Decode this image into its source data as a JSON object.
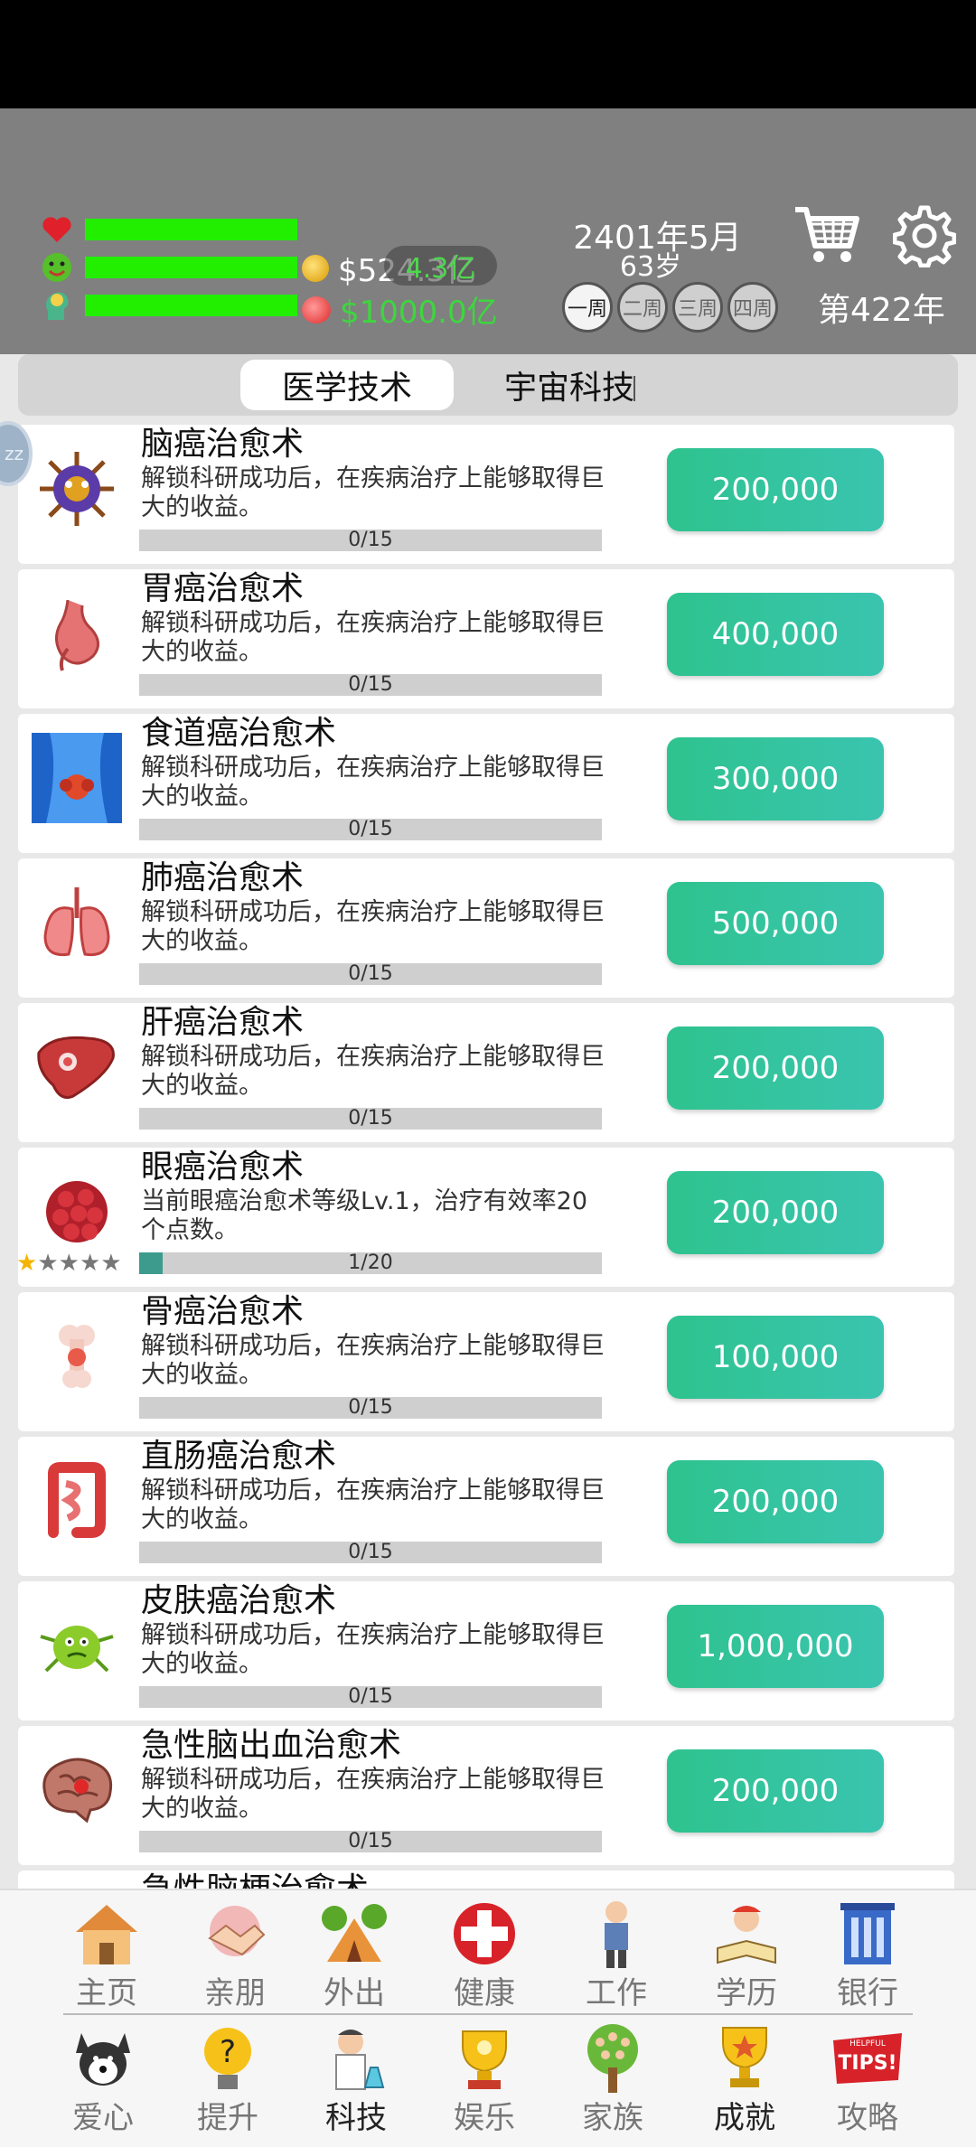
{
  "header": {
    "money": "$524.3亿",
    "ghost_value": "4.3亿",
    "gems": "$1000.0亿",
    "date": "2401年5月",
    "age": "63岁",
    "weeks": [
      "一周",
      "二周",
      "三周",
      "四周"
    ],
    "active_week": "一周",
    "year": "第422年",
    "stat_bar_color": "#22ee00"
  },
  "tabs": {
    "active": "医学技术",
    "second": "宇宙科技"
  },
  "side_bubble": "zz",
  "techs": [
    {
      "title": "脑癌治愈术",
      "desc": "解锁科研成功后，在疾病治疗上能够取得巨大的收益。",
      "progress": "0/15",
      "progress_fraction": 0,
      "price": "200,000"
    },
    {
      "title": "胃癌治愈术",
      "desc": "解锁科研成功后，在疾病治疗上能够取得巨大的收益。",
      "progress": "0/15",
      "progress_fraction": 0,
      "price": "400,000"
    },
    {
      "title": "食道癌治愈术",
      "desc": "解锁科研成功后，在疾病治疗上能够取得巨大的收益。",
      "progress": "0/15",
      "progress_fraction": 0,
      "price": "300,000"
    },
    {
      "title": "肺癌治愈术",
      "desc": "解锁科研成功后，在疾病治疗上能够取得巨大的收益。",
      "progress": "0/15",
      "progress_fraction": 0,
      "price": "500,000"
    },
    {
      "title": "肝癌治愈术",
      "desc": "解锁科研成功后，在疾病治疗上能够取得巨大的收益。",
      "progress": "0/15",
      "progress_fraction": 0,
      "price": "200,000"
    },
    {
      "title": "眼癌治愈术",
      "desc": "当前眼癌治愈术等级Lv.1，治疗有效率20个点数。",
      "progress": "1/20",
      "progress_fraction": 0.05,
      "price": "200,000",
      "stars": 1
    },
    {
      "title": "骨癌治愈术",
      "desc": "解锁科研成功后，在疾病治疗上能够取得巨大的收益。",
      "progress": "0/15",
      "progress_fraction": 0,
      "price": "100,000"
    },
    {
      "title": "直肠癌治愈术",
      "desc": "解锁科研成功后，在疾病治疗上能够取得巨大的收益。",
      "progress": "0/15",
      "progress_fraction": 0,
      "price": "200,000"
    },
    {
      "title": "皮肤癌治愈术",
      "desc": "解锁科研成功后，在疾病治疗上能够取得巨大的收益。",
      "progress": "0/15",
      "progress_fraction": 0,
      "price": "1,000,000"
    },
    {
      "title": "急性脑出血治愈术",
      "desc": "解锁科研成功后，在疾病治疗上能够取得巨大的收益。",
      "progress": "0/15",
      "progress_fraction": 0,
      "price": "200,000"
    },
    {
      "title": "急性脑梗治愈术",
      "desc": "",
      "progress": "",
      "progress_fraction": 0,
      "price": ""
    }
  ],
  "nav": {
    "row1": [
      "主页",
      "亲朋",
      "外出",
      "健康",
      "工作",
      "学历",
      "银行"
    ],
    "row2": [
      "爱心",
      "提升",
      "科技",
      "娱乐",
      "家族",
      "成就",
      "攻略"
    ],
    "tips_badge": "TIPS!",
    "tips_badge_top": "HELPFUL",
    "active": "科技"
  },
  "colors": {
    "header_bg": "#808080",
    "button_start": "#2ec38e",
    "button_end": "#3ac4b0",
    "progress_fill": "#3d9b8e"
  }
}
